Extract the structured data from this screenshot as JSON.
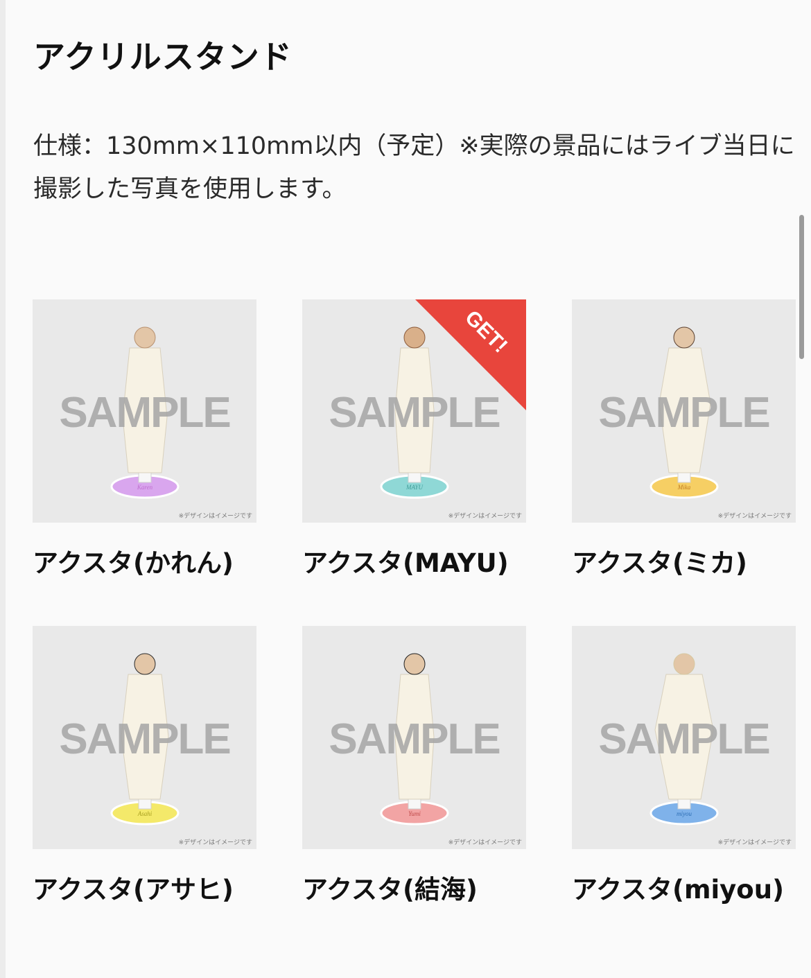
{
  "page": {
    "title": "アクリルスタンド",
    "description": "仕様：130mm×110mm以内（予定）※実際の景品にはライブ当日に撮影した写真を使用します。"
  },
  "items": [
    {
      "label": "アクスタ(かれん)",
      "base_name": "Karen",
      "watermark": "SAMPLE",
      "note": "※デザインはイメージです",
      "base_color": "#d9a6ee",
      "obtained": false,
      "badge": ""
    },
    {
      "label": "アクスタ(MAYU)",
      "base_name": "MAYU",
      "watermark": "SAMPLE",
      "note": "※デザインはイメージです",
      "base_color": "#8fd8d6",
      "obtained": true,
      "badge": "GET!"
    },
    {
      "label": "アクスタ(ミカ)",
      "base_name": "Mika",
      "watermark": "SAMPLE",
      "note": "※デザインはイメージです",
      "base_color": "#f6cf64",
      "obtained": false,
      "badge": ""
    },
    {
      "label": "アクスタ(アサヒ)",
      "base_name": "Asahi",
      "watermark": "SAMPLE",
      "note": "※デザインはイメージです",
      "base_color": "#f4e96a",
      "obtained": false,
      "badge": ""
    },
    {
      "label": "アクスタ(結海)",
      "base_name": "Yumi",
      "watermark": "SAMPLE",
      "note": "※デザインはイメージです",
      "base_color": "#f2a4a4",
      "obtained": false,
      "badge": ""
    },
    {
      "label": "アクスタ(miyou)",
      "base_name": "miyou",
      "watermark": "SAMPLE",
      "note": "※デザインはイメージです",
      "base_color": "#7fb2ea",
      "obtained": false,
      "badge": ""
    }
  ],
  "colors": {
    "badge": "#e8453c",
    "thumb_bg": "#e9e9e9"
  }
}
